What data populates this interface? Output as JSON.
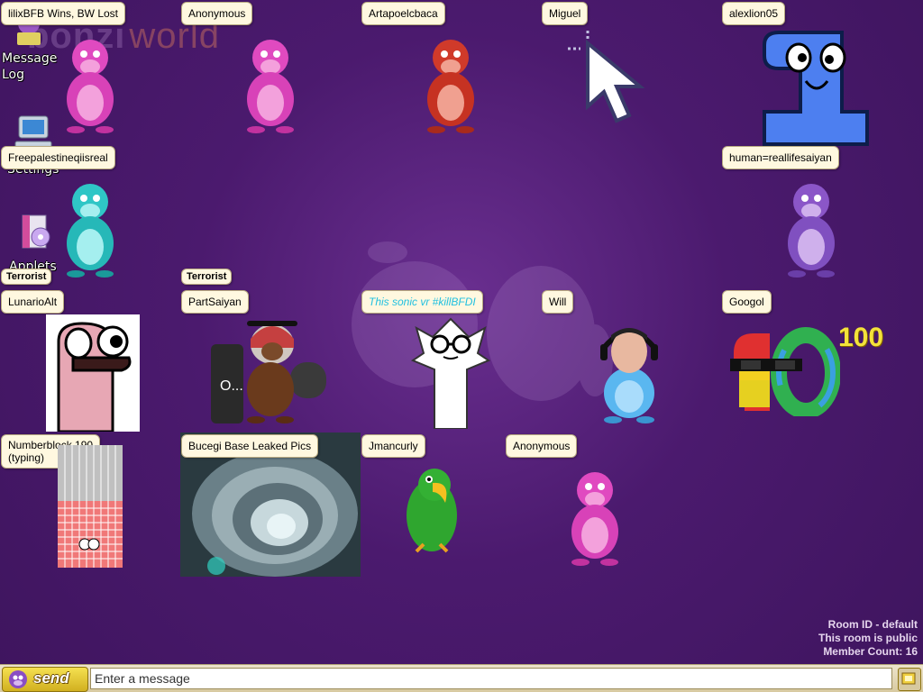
{
  "app": {
    "logo": {
      "main": "bonzi",
      "sub": "world"
    }
  },
  "sidebar": {
    "items": [
      {
        "label": "Message Log",
        "icon": "bonzi-book-icon"
      },
      {
        "label": "Settings",
        "icon": "computer-icon"
      },
      {
        "label": "Applets",
        "icon": "software-box-icon"
      }
    ]
  },
  "users": [
    {
      "name": "lilixBFB Wins, BW Lost",
      "avatar": "bonzi-pink"
    },
    {
      "name": "Anonymous",
      "avatar": "bonzi-pink"
    },
    {
      "name": "Artapoelcbaca",
      "avatar": "bonzi-red"
    },
    {
      "name": "Miguel",
      "avatar": "mouse-cursor"
    },
    {
      "name": "alexlion05",
      "avatar": "blue-number-character"
    },
    {
      "name": "Freepalestineqiisreal",
      "avatar": "bonzi-cyan"
    },
    {
      "name": "human=reallifesaiyan",
      "avatar": "bonzi-purple"
    },
    {
      "name": "LunarioAlt",
      "avatar": "pink-cartoon-face",
      "badge": "Terrorist"
    },
    {
      "name": "PartSaiyan",
      "avatar": "bonzi-brown-headscarf",
      "badge": "Terrorist",
      "typing_text": "O..."
    },
    {
      "name": "This sonic vr #killBFDI",
      "avatar": "white-cartoon-character"
    },
    {
      "name": "Will",
      "avatar": "bonzi-cyan-face"
    },
    {
      "name": "Googol",
      "avatar": "numberblock-googol",
      "extra": "100"
    },
    {
      "name": "Numberblock 190",
      "status": "(typing)",
      "avatar": "numberblock-190"
    },
    {
      "name": "Bucegi Base Leaked Pics",
      "avatar": "tunnel-photo"
    },
    {
      "name": "Jmancurly",
      "avatar": "green-parrot"
    },
    {
      "name": "Anonymous",
      "avatar": "bonzi-pink"
    }
  ],
  "room": {
    "id_line": "Room ID - default",
    "public_line": "This room is public",
    "count_line": "Member Count: 16"
  },
  "chat": {
    "send_label": "send",
    "placeholder": "Enter a message"
  },
  "colors": {
    "background": "#4b1a6e",
    "bar": "#ede4cc",
    "send": "#f0d63c"
  }
}
